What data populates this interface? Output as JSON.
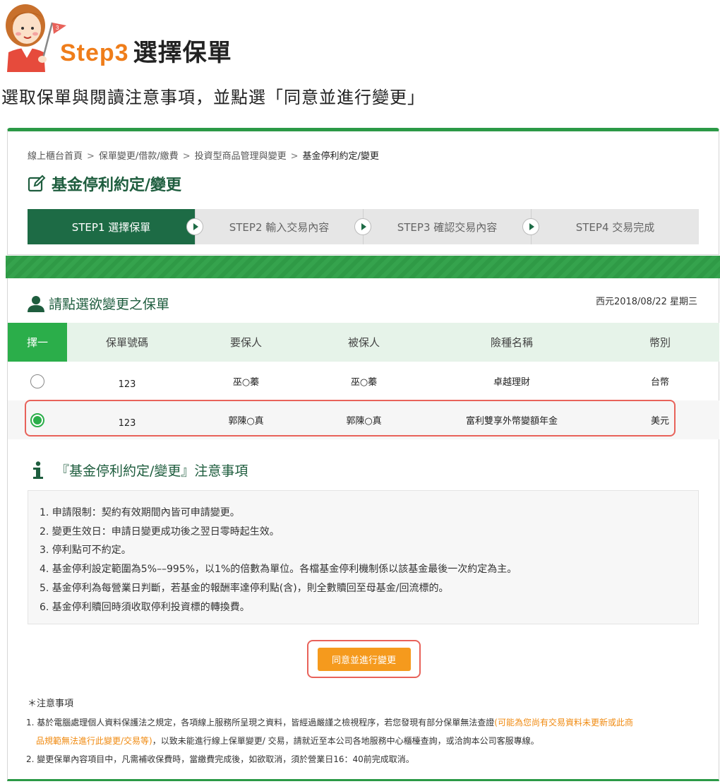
{
  "header": {
    "step_num": "Step3",
    "step_title": "選擇保單",
    "flag_num": "3",
    "subtitle": "選取保單與閱讀注意事項，並點選「同意並進行變更」"
  },
  "breadcrumb": [
    "線上櫃台首頁",
    "保單變更/借款/繳費",
    "投資型商品管理與變更",
    "基金停利約定/變更"
  ],
  "breadcrumb_sep": ">",
  "page_title": "基金停利約定/變更",
  "steps": [
    {
      "label": "STEP1 選擇保單",
      "active": true
    },
    {
      "label": "STEP2 輸入交易內容",
      "active": false
    },
    {
      "label": "STEP3 確認交易內容",
      "active": false
    },
    {
      "label": "STEP4 交易完成",
      "active": false
    }
  ],
  "select_title": "請點選欲變更之保單",
  "date": "西元2018/08/22 星期三",
  "table": {
    "headers": [
      "擇一",
      "保單號碼",
      "要保人",
      "被保人",
      "險種名稱",
      "幣別"
    ],
    "rows": [
      {
        "selected": false,
        "policy_no": "123",
        "applicant": "巫○蓁",
        "insured": "巫○蓁",
        "product": "卓越理財",
        "currency": "台幣"
      },
      {
        "selected": true,
        "policy_no": "123",
        "applicant": "郭陳○真",
        "insured": "郭陳○真",
        "product": "富利雙享外幣變額年金",
        "currency": "美元"
      }
    ]
  },
  "notice_title": "『基金停利約定/變更』注意事項",
  "notices": [
    "1. 申請限制：契約有效期間內皆可申請變更。",
    "2. 變更生效日：申請日變更成功後之翌日零時起生效。",
    "3. 停利點可不約定。",
    "4. 基金停利設定範圍為5%––995%，以1%的倍數為單位。各檔基金停利機制係以該基金最後一次約定為主。",
    "5. 基金停利為每營業日判斷，若基金的報酬率達停利點(含)，則全數贖回至母基金/回流標的。",
    "6. 基金停利贖回時須收取停利投資標的轉換費。"
  ],
  "agree_button": "同意並進行變更",
  "footnotes": {
    "title": "＊注意事項",
    "item1_a": "1. 基於電腦處理個人資料保護法之規定，各項線上服務所呈現之資料，皆經過嚴謹之檢視程序，若您發現有部分保單無法查證",
    "item1_orange_1": "(可能為您尚有交易資料未更新或此商",
    "item1_orange_2": "品規範無法進行此變更/交易等)",
    "item1_b": "，以致未能進行線上保單變更/ 交易，請就近至本公司各地服務中心櫃檯查詢，或洽詢本公司客服專線。",
    "item2": "2. 變更保單內容項目中，凡需補收保費時，當繳費完成後，如欲取消，須於營業日16：40前完成取消。"
  },
  "colors": {
    "brand_green": "#1d6b45",
    "accent_green": "#2bae4a",
    "orange": "#f59a1d",
    "highlight_red": "#e8625a"
  }
}
